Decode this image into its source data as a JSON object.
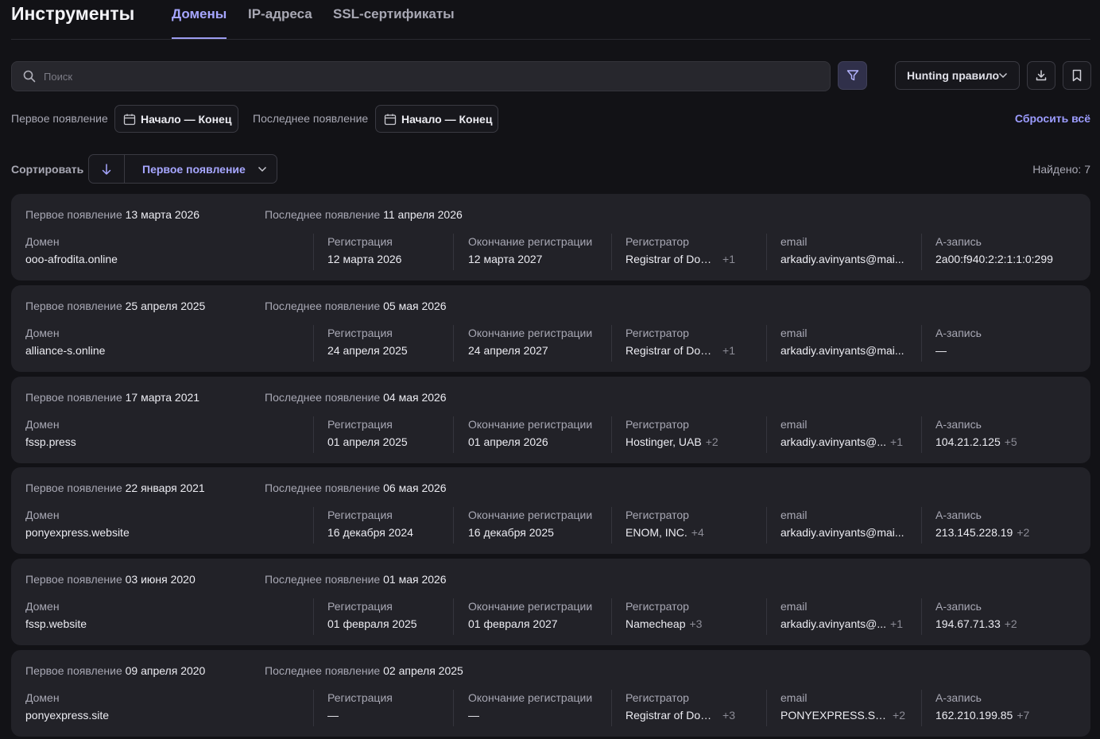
{
  "header": {
    "title": "Инструменты",
    "tabs": [
      {
        "label": "Домены",
        "active": true
      },
      {
        "label": "IP-адреса",
        "active": false
      },
      {
        "label": "SSL-сертификаты",
        "active": false
      }
    ]
  },
  "search": {
    "placeholder": "Поиск",
    "value": ""
  },
  "toolbar": {
    "hunting_label": "Hunting правило"
  },
  "filters": {
    "first_seen_label": "Первое появление",
    "first_seen_value": "Начало — Конец",
    "last_seen_label": "Последнее появление",
    "last_seen_value": "Начало — Конец",
    "reset_label": "Сбросить всё"
  },
  "sort": {
    "label": "Сортировать",
    "field": "Первое появление",
    "direction": "desc"
  },
  "found": {
    "label": "Найдено:",
    "count": "7"
  },
  "labels": {
    "first_seen": "Первое появление",
    "last_seen": "Последнее появление",
    "domain": "Домен",
    "registration": "Регистрация",
    "expiration": "Окончание регистрации",
    "registrar": "Регистратор",
    "email": "email",
    "a_record": "A-запись"
  },
  "colors": {
    "accent": "#a6a6ff",
    "background": "#121216",
    "card": "#222228",
    "muted": "#a8a8b4"
  },
  "domains": [
    {
      "first_seen": "13 марта 2026",
      "last_seen": "11 апреля 2026",
      "domain": "ooo-afrodita.online",
      "registration": "12 марта 2026",
      "expiration": "12 марта 2027",
      "registrar": "Registrar of Domain...",
      "registrar_more": "+1",
      "email": "arkadiy.avinyants@mai...",
      "email_more": "",
      "a_record": "2a00:f940:2:2:1:1:0:299",
      "a_more": ""
    },
    {
      "first_seen": "25 апреля 2025",
      "last_seen": "05 мая 2026",
      "domain": "alliance-s.online",
      "registration": "24 апреля 2025",
      "expiration": "24 апреля 2027",
      "registrar": "Registrar of Domain...",
      "registrar_more": "+1",
      "email": "arkadiy.avinyants@mai...",
      "email_more": "",
      "a_record": "—",
      "a_more": ""
    },
    {
      "first_seen": "17 марта 2021",
      "last_seen": "04 мая 2026",
      "domain": "fssp.press",
      "registration": "01 апреля 2025",
      "expiration": "01 апреля 2026",
      "registrar": "Hostinger, UAB",
      "registrar_more": "+2",
      "email": "arkadiy.avinyants@...",
      "email_more": "+1",
      "a_record": "104.21.2.125",
      "a_more": "+5"
    },
    {
      "first_seen": "22 января 2021",
      "last_seen": "06 мая 2026",
      "domain": "ponyexpress.website",
      "registration": "16 декабря 2024",
      "expiration": "16 декабря 2025",
      "registrar": "ENOM, INC.",
      "registrar_more": "+4",
      "email": "arkadiy.avinyants@mai...",
      "email_more": "",
      "a_record": "213.145.228.19",
      "a_more": "+2"
    },
    {
      "first_seen": "03 июня 2020",
      "last_seen": "01 мая 2026",
      "domain": "fssp.website",
      "registration": "01 февраля 2025",
      "expiration": "01 февраля 2027",
      "registrar": "Namecheap",
      "registrar_more": "+3",
      "email": "arkadiy.avinyants@...",
      "email_more": "+1",
      "a_record": "194.67.71.33",
      "a_more": "+2"
    },
    {
      "first_seen": "09 апреля 2020",
      "last_seen": "02 апреля 2025",
      "domain": "ponyexpress.site",
      "registration": "—",
      "expiration": "—",
      "registrar": "Registrar of Domain...",
      "registrar_more": "+3",
      "email": "PONYEXPRESS.SIT...",
      "email_more": "+2",
      "a_record": "162.210.199.85",
      "a_more": "+7"
    }
  ]
}
